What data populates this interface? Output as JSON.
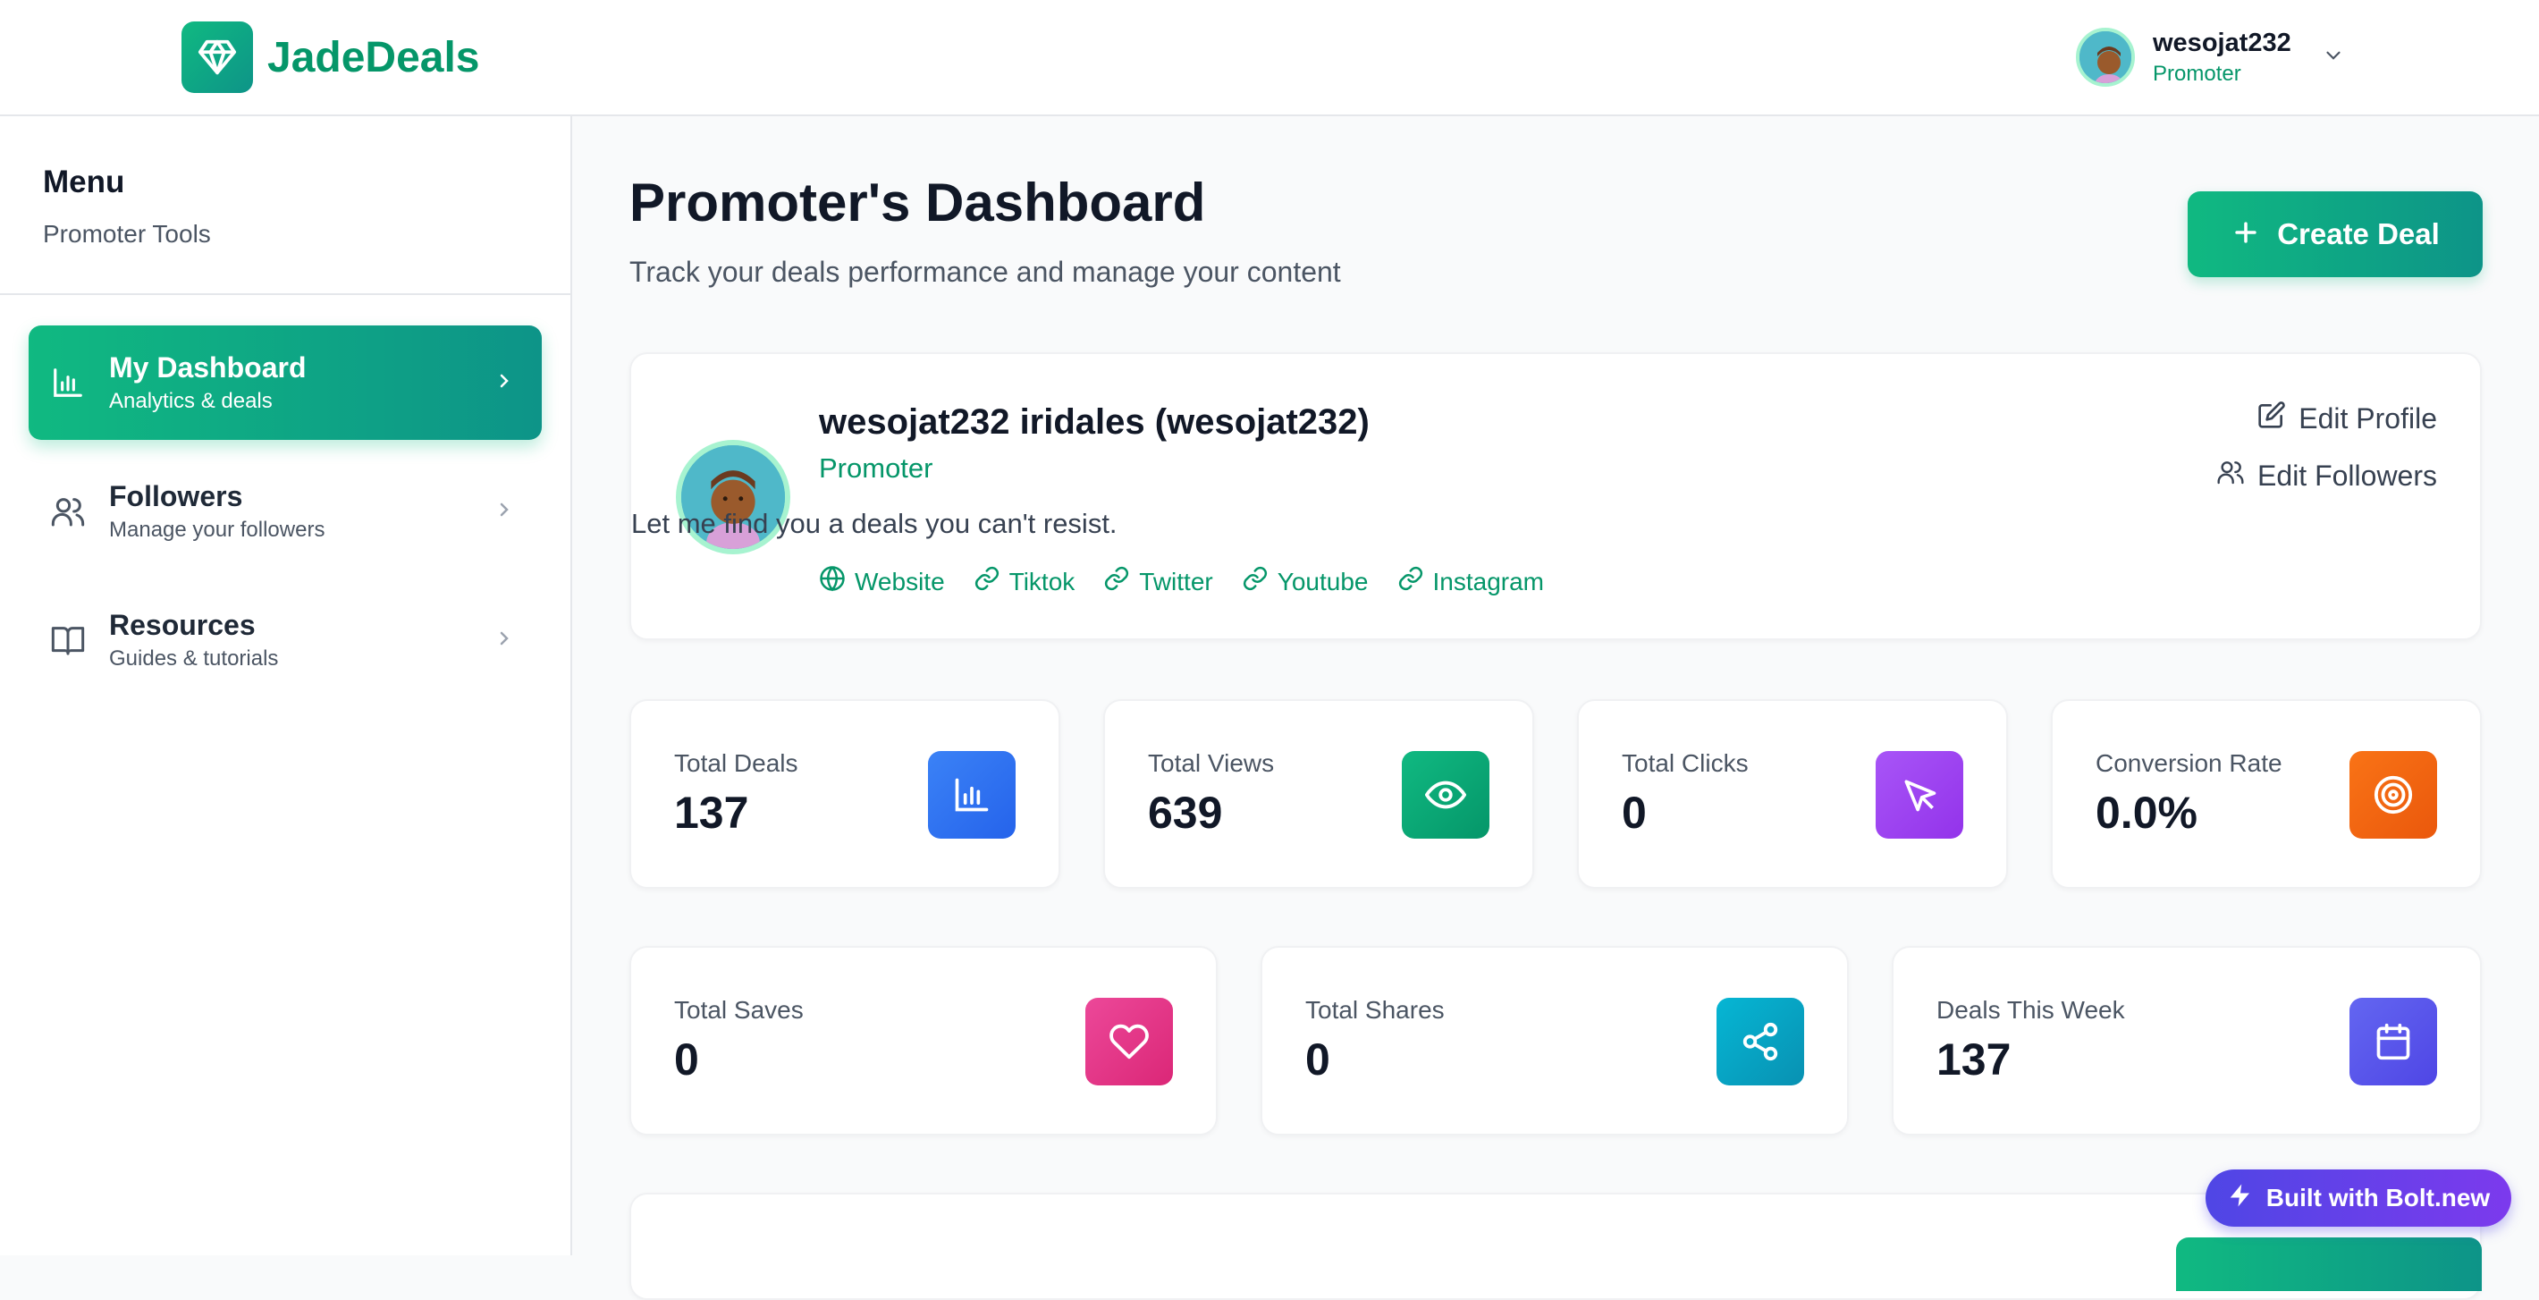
{
  "app": {
    "name": "JadeDeals",
    "brand_color": "#059669"
  },
  "header": {
    "logo_icon": "gem-icon",
    "user": {
      "name": "wesojat232",
      "role": "Promoter"
    }
  },
  "sidebar": {
    "title": "Menu",
    "subtitle": "Promoter Tools",
    "items": [
      {
        "label": "My Dashboard",
        "desc": "Analytics & deals",
        "icon": "bar-chart-icon",
        "active": true
      },
      {
        "label": "Followers",
        "desc": "Manage your followers",
        "icon": "users-icon",
        "active": false
      },
      {
        "label": "Resources",
        "desc": "Guides & tutorials",
        "icon": "book-icon",
        "active": false
      }
    ]
  },
  "main": {
    "title": "Promoter's Dashboard",
    "subtitle": "Track your deals performance and manage your content",
    "create_label": "Create Deal",
    "profile": {
      "display_name": "wesojat232 iridales (wesojat232)",
      "role": "Promoter",
      "bio": "Let me find you a deals you can't resist.",
      "links": [
        "Website",
        "Tiktok",
        "Twitter",
        "Youtube",
        "Instagram"
      ],
      "edit_profile": "Edit Profile",
      "edit_followers": "Edit Followers"
    },
    "stats_row1": [
      {
        "label": "Total Deals",
        "value": "137",
        "icon": "bar-chart-icon",
        "color": "#3b82f6"
      },
      {
        "label": "Total Views",
        "value": "639",
        "icon": "eye-icon",
        "color": "#10b981"
      },
      {
        "label": "Total Clicks",
        "value": "0",
        "icon": "cursor-icon",
        "color": "#a855f7"
      },
      {
        "label": "Conversion Rate",
        "value": "0.0%",
        "icon": "target-icon",
        "color": "#f97316"
      }
    ],
    "stats_row2": [
      {
        "label": "Total Saves",
        "value": "0",
        "icon": "heart-icon",
        "color": "#ec4899"
      },
      {
        "label": "Total Shares",
        "value": "0",
        "icon": "share-icon",
        "color": "#06b6d4"
      },
      {
        "label": "Deals This Week",
        "value": "137",
        "icon": "calendar-icon",
        "color": "#6366f1"
      }
    ]
  },
  "badge": {
    "label": "Built with Bolt.new"
  }
}
